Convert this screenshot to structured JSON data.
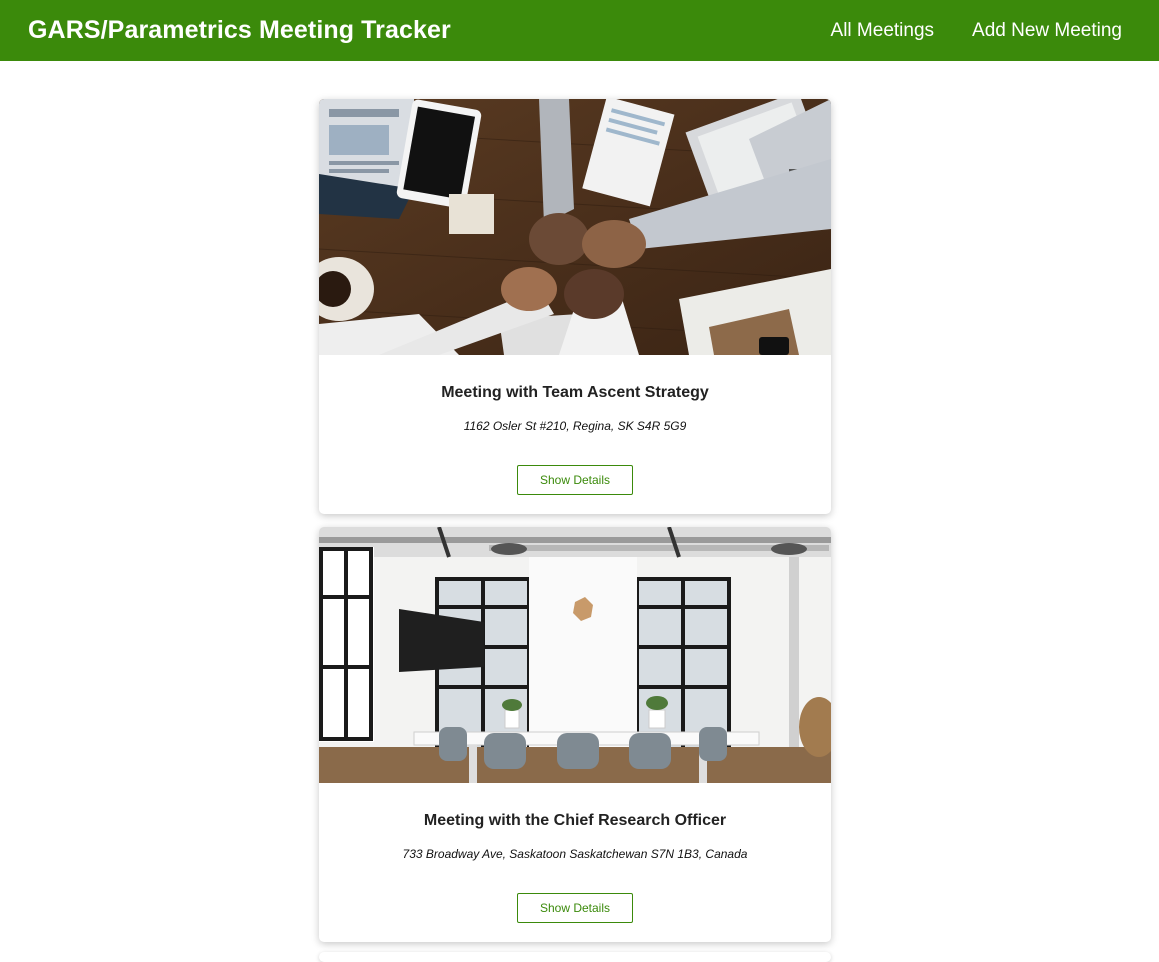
{
  "header": {
    "title": "GARS/Parametrics Meeting Tracker",
    "nav": [
      {
        "label": "All Meetings"
      },
      {
        "label": "Add New Meeting"
      }
    ]
  },
  "meetings": [
    {
      "title": "Meeting with Team Ascent Strategy",
      "address": "1162 Osler St #210, Regina, SK S4R 5G9",
      "button_label": "Show Details",
      "image": "team fist-bump over desk photo"
    },
    {
      "title": "Meeting with the Chief Research Officer",
      "address": "733 Broadway Ave, Saskatoon Saskatchewan S7N 1B3, Canada",
      "button_label": "Show Details",
      "image": "white conference room photo"
    }
  ],
  "colors": {
    "brand_green": "#3b8a0b",
    "header_text": "#ffffff"
  }
}
